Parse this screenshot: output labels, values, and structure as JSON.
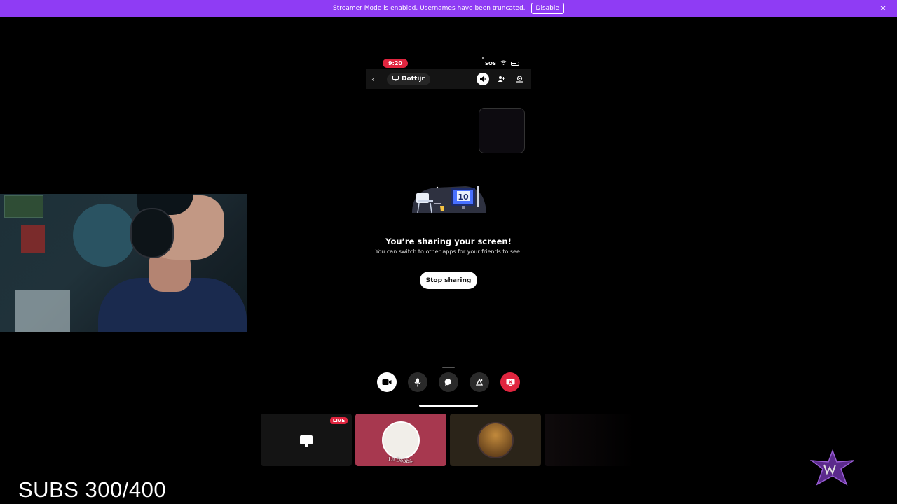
{
  "banner": {
    "message": "Streamer Mode is enabled. Usernames have been truncated.",
    "disable_label": "Disable",
    "close_icon": "close-icon",
    "color": "#8f3cf4"
  },
  "status_bar": {
    "time": "9:20",
    "carrier": "SOS"
  },
  "call_header": {
    "channel_name": "Dottijr"
  },
  "sharing": {
    "title": "You’re sharing your screen!",
    "subtitle": "You can switch to other apps for your friends to see.",
    "stop_label": "Stop sharing",
    "illustration_number": "10"
  },
  "controls": {
    "items": [
      "camera-icon",
      "microphone-icon",
      "chat-icon",
      "activity-icon",
      "end-stream-icon"
    ],
    "end_color": "#e0253f"
  },
  "participants": {
    "live_label": "LIVE",
    "debbie_label": "Lil Debbie",
    "debbie_color": "#a7384f"
  },
  "overlay": {
    "subs_text": "SUBS 300/400"
  }
}
